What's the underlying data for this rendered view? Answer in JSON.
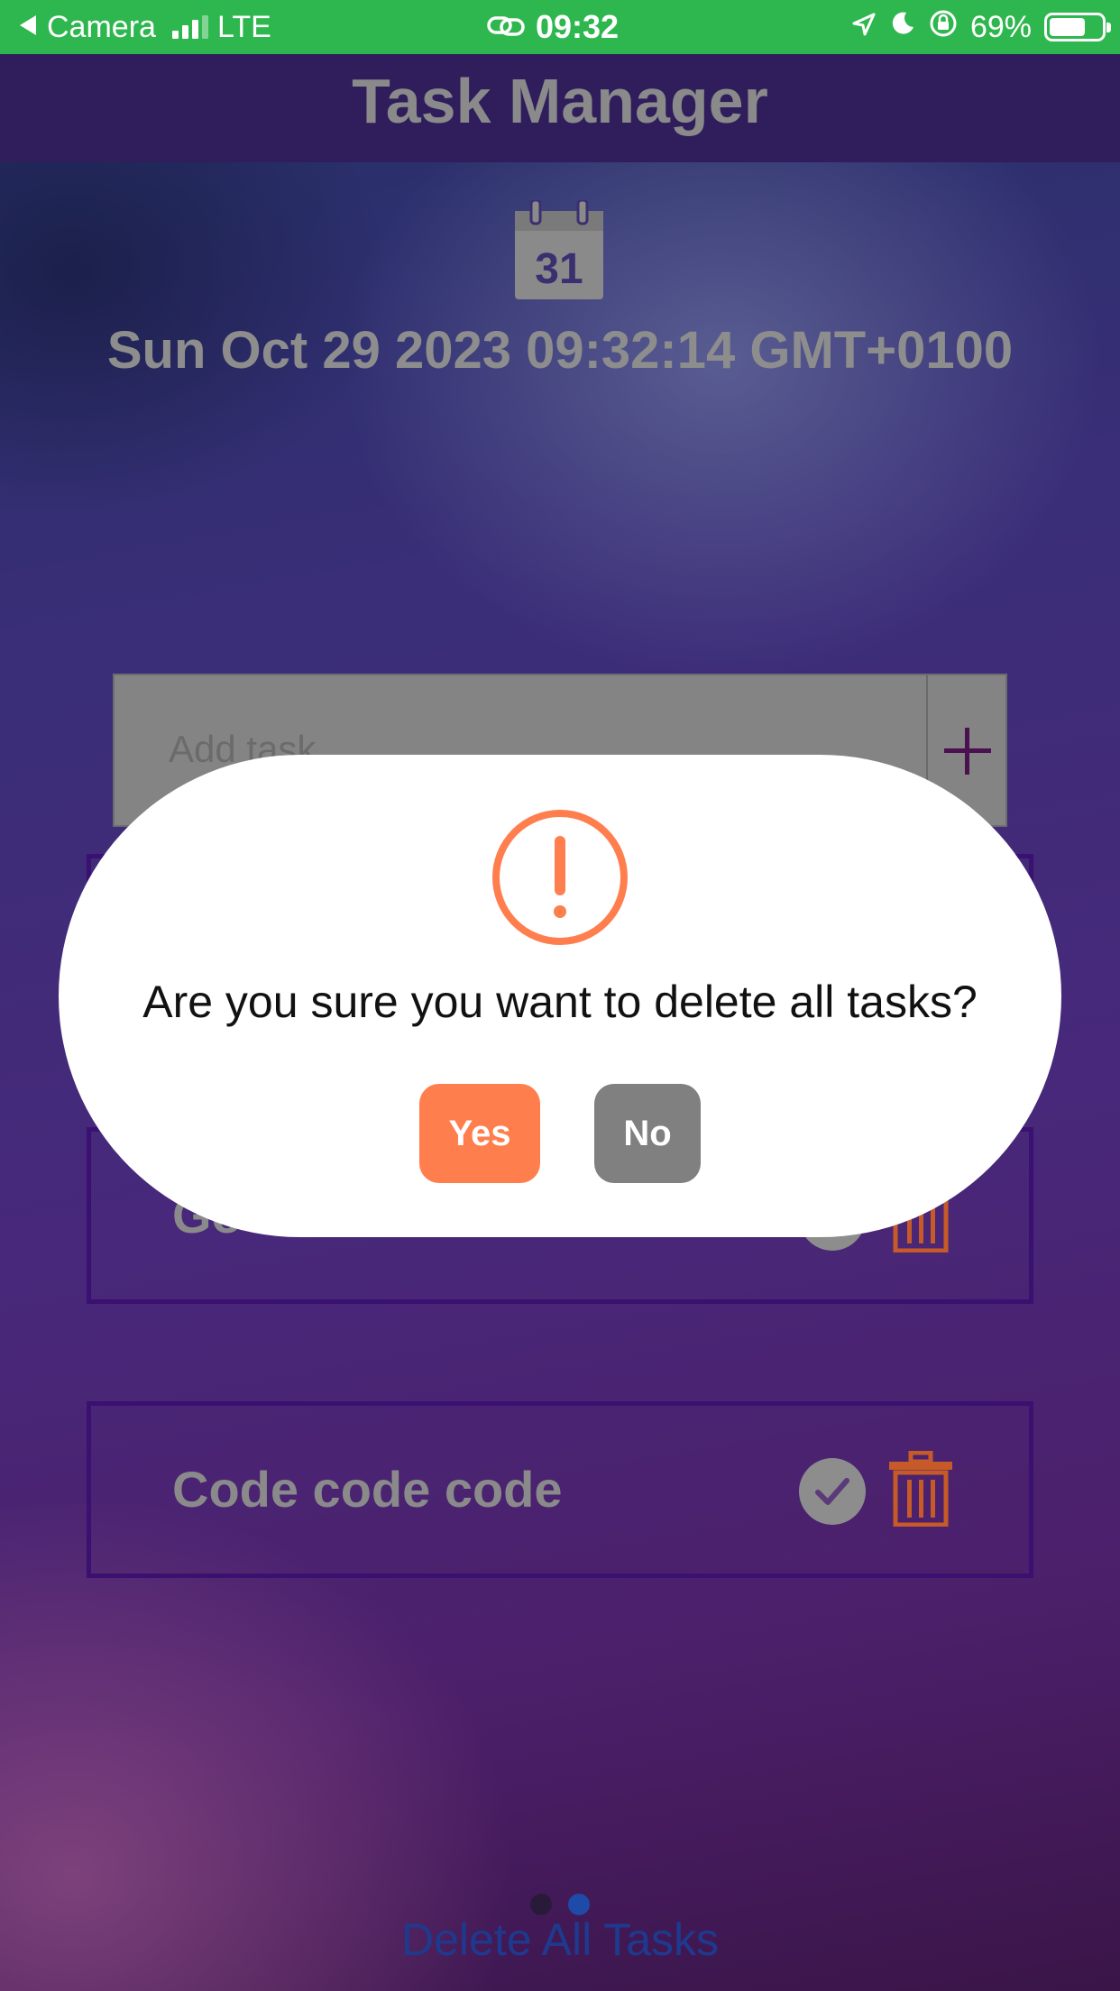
{
  "status_bar": {
    "back_label": "Camera",
    "network": "LTE",
    "time": "09:32",
    "battery": "69%",
    "battery_level": 0.69
  },
  "header": {
    "title": "Task Manager"
  },
  "calendar": {
    "day": "31"
  },
  "datetime": "Sun Oct 29 2023 09:32:14 GMT+0100",
  "add_task": {
    "placeholder": "Add task",
    "add_icon": "plus-icon"
  },
  "tasks": [
    {
      "label": "Go"
    },
    {
      "label": "Code code code"
    }
  ],
  "pager": {
    "count": 2,
    "active_index": 1
  },
  "delete_all_label": "Delete All Tasks",
  "modal": {
    "icon": "exclamation-icon",
    "message": "Are you sure you want to delete all tasks?",
    "yes_label": "Yes",
    "no_label": "No"
  },
  "colors": {
    "status_bar": "#2eb74e",
    "header": "#2f1d5c",
    "accent_orange": "#ff7e4e",
    "button_gray": "#808080",
    "task_border": "#3a1070",
    "trash": "#c65a28",
    "link_blue": "#1e3a8f"
  }
}
